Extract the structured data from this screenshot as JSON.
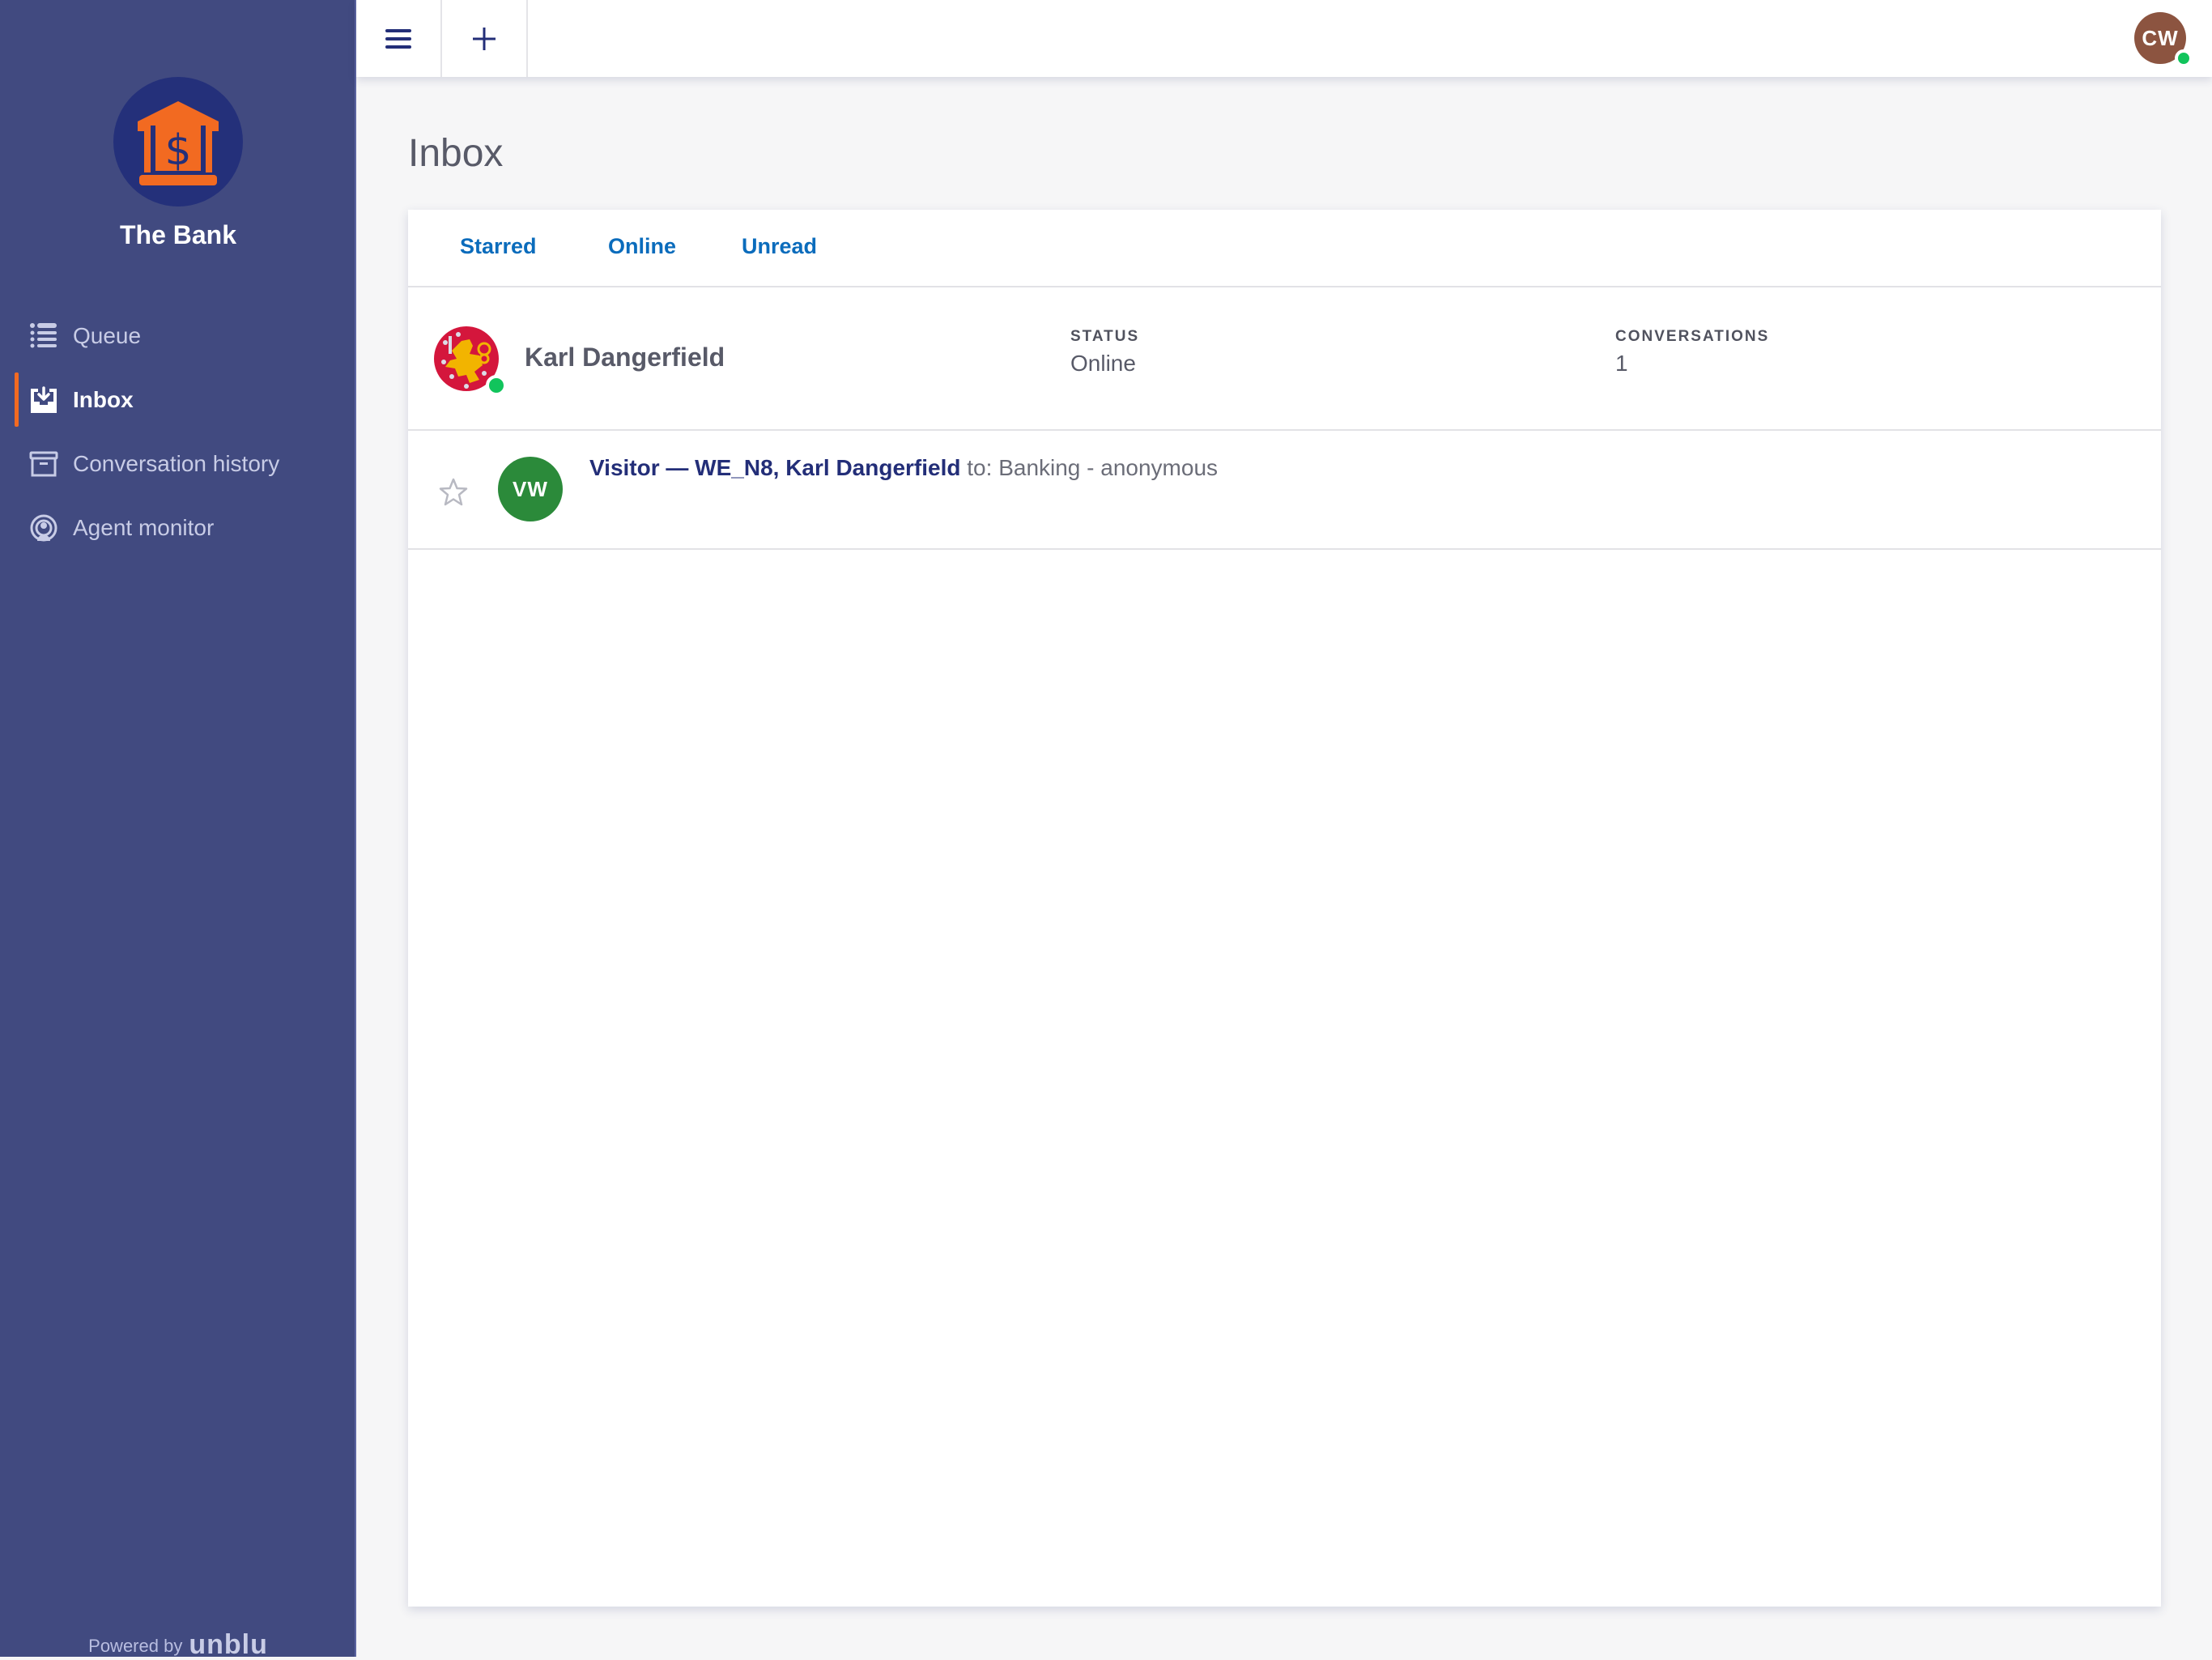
{
  "brand": {
    "name": "The Bank",
    "logo_icon": "bank-building-dollar-icon",
    "accent_color": "#f26a21",
    "sidebar_color": "#414a80"
  },
  "sidebar": {
    "items": [
      {
        "label": "Queue",
        "icon": "list-icon",
        "active": false
      },
      {
        "label": "Inbox",
        "icon": "inbox-download-icon",
        "active": true
      },
      {
        "label": "Conversation history",
        "icon": "archive-box-icon",
        "active": false
      },
      {
        "label": "Agent monitor",
        "icon": "agent-broadcast-icon",
        "active": false
      }
    ],
    "powered_by": "Powered by",
    "powered_by_brand": "unblu"
  },
  "topbar": {
    "menu_icon": "hamburger-menu-icon",
    "add_icon": "plus-icon",
    "user_initials": "CW",
    "user_status": "online"
  },
  "page": {
    "title": "Inbox"
  },
  "filters": {
    "tabs": [
      {
        "label": "Starred"
      },
      {
        "label": "Online"
      },
      {
        "label": "Unread"
      }
    ]
  },
  "agent": {
    "name": "Karl Dangerfield",
    "presence": "online",
    "status_label": "STATUS",
    "status_value": "Online",
    "conversations_label": "CONVERSATIONS",
    "conversations_value": "1"
  },
  "conversations": [
    {
      "starred": false,
      "avatar_initials": "VW",
      "avatar_color": "#2b8a3a",
      "participants": "Visitor — WE_N8, Karl Dangerfield",
      "recipient": "to: Banking - anonymous"
    }
  ]
}
